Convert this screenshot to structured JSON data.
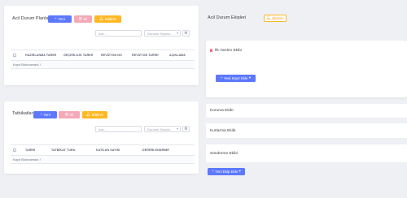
{
  "colors": {
    "primary": "#5d78ff",
    "danger_light": "#f4a9b8",
    "warning": "#ffb822",
    "background": "#eef0f3"
  },
  "plans": {
    "title": "Acil Durum Planları",
    "new_label": "Yeni",
    "delete_label": "Sil",
    "notify_label": "Bildirim",
    "search_placeholder": "Ara...",
    "status_select": "Durumu Seçiniz...",
    "columns": [
      "HAZIRLANMA TARİHİ",
      "GEÇERLİLİK TARİHİ",
      "REVİZYON NO",
      "REVİZYON TARİHİ",
      "AÇIKLAMA"
    ],
    "empty_text": "Kayıt Bulunamadı !"
  },
  "drills": {
    "title": "Tatbikatlar",
    "new_label": "Yeni",
    "delete_label": "Sil",
    "notify_label": "Bildirim",
    "search_placeholder": "Ara...",
    "status_select": "Durumu Seçiniz...",
    "columns": [
      "TARİHİ",
      "TATBİKAT TÜRÜ",
      "KATILAN SAYISI",
      "DEĞERLENDİRME"
    ],
    "empty_text": "Kayıt Bulunamadı !"
  },
  "teams": {
    "title": "Acil Durum Ekipleri",
    "notify_label": "Bildirim",
    "first_aid": "İlk Yardım Ekibi",
    "add_record_label": "Yeni Kayıt Ekle",
    "protection": "Koruma Ekibi",
    "rescue": "Kurtarma Ekibi",
    "firefighting": "Söndürme Ekibi",
    "add_team_label": "Yeni Ekip Ekle"
  }
}
